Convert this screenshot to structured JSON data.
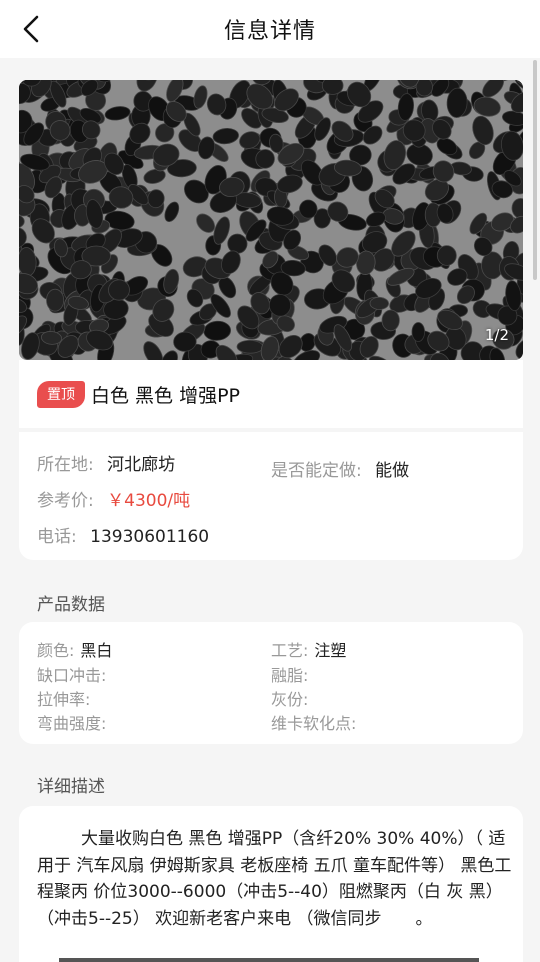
{
  "nav": {
    "title": "信息详情",
    "back_icon": "chevron-left-icon"
  },
  "gallery": {
    "image_description": "black-plastic-pellets-photo",
    "counter": "1/2"
  },
  "listing": {
    "badge": "置顶",
    "title": "白色 黑色 增强PP"
  },
  "info": {
    "location_label": "所在地:",
    "location_value": "河北廊坊",
    "custom_label": "是否能定做:",
    "custom_value": "能做",
    "price_label": "参考价:",
    "price_value": "￥4300/吨",
    "phone_label": "电话:",
    "phone_value": "13930601160"
  },
  "product_data": {
    "section_title": "产品数据",
    "fields": [
      {
        "label": "颜色:",
        "value": "黑白"
      },
      {
        "label": "工艺:",
        "value": "注塑"
      },
      {
        "label": "缺口冲击:",
        "value": ""
      },
      {
        "label": "融脂:",
        "value": ""
      },
      {
        "label": "拉伸率:",
        "value": ""
      },
      {
        "label": "灰份:",
        "value": ""
      },
      {
        "label": "弯曲强度:",
        "value": ""
      },
      {
        "label": "维卡软化点:",
        "value": ""
      }
    ]
  },
  "description": {
    "section_title": "详细描述",
    "text": "大量收购白色 黑色 增强PP（含纤20% 30% 40%）（ 适用于 汽车风扇 伊姆斯家具 老板座椅 五爪 童车配件等） 黑色工程聚丙 价位3000--6000（冲击5--40）阻燃聚丙（白 灰 黑）（冲击5--25） 欢迎新老客户来电 （微信同步　　。"
  },
  "colors": {
    "accent": "#e94e4e",
    "price": "#e84a3f",
    "background": "#f5f5f5"
  }
}
